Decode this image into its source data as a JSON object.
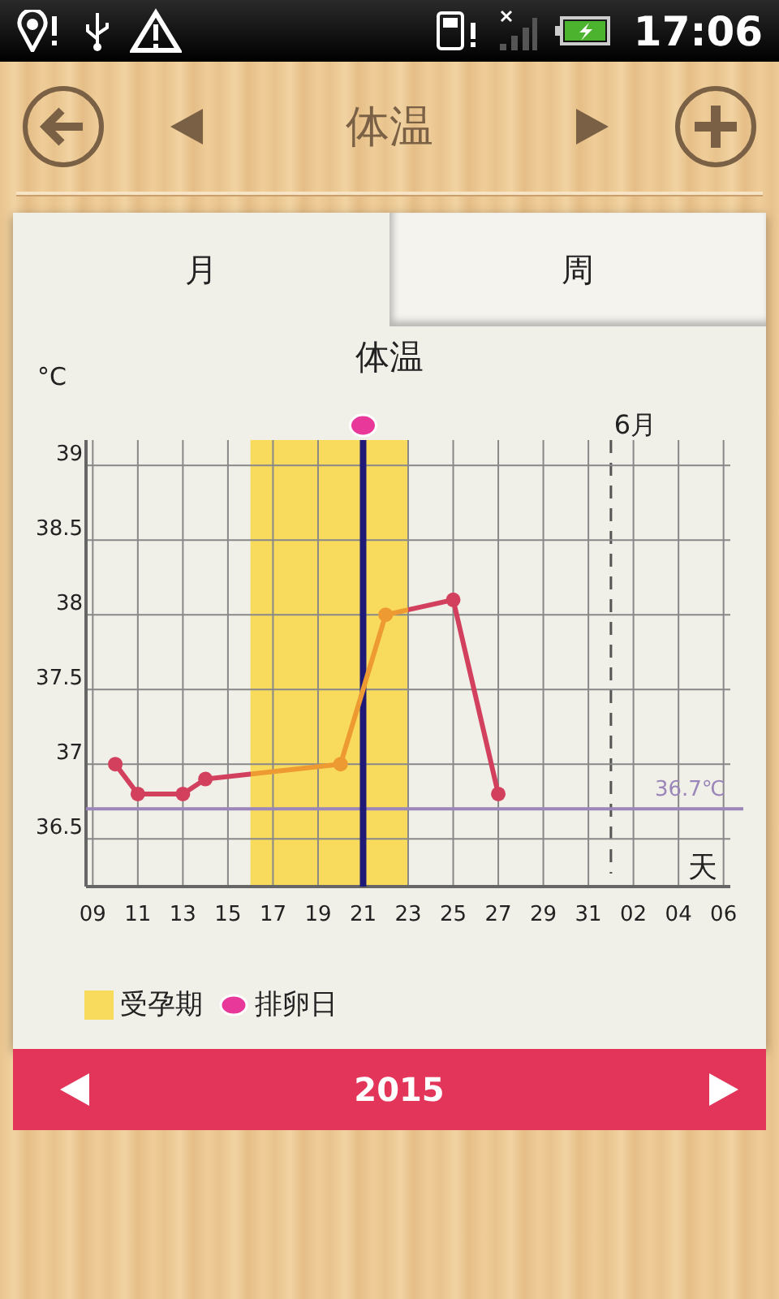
{
  "status_bar": {
    "time": "17:06"
  },
  "header": {
    "title": "体温"
  },
  "tabs": [
    {
      "label": "月",
      "selected": true
    },
    {
      "label": "周",
      "selected": false
    }
  ],
  "chart_data": {
    "type": "line",
    "title": "体温",
    "xlabel": "天",
    "ylabel": "°C",
    "categories": [
      "09",
      null,
      "11",
      null,
      "13",
      null,
      "15",
      null,
      "17",
      null,
      "19",
      null,
      "21",
      null,
      "23",
      null,
      "25",
      null,
      "27",
      null,
      "29",
      null,
      "31",
      null,
      "02",
      null,
      "04",
      null,
      "06"
    ],
    "grid": true,
    "ref_lines": [
      {
        "axis": "y",
        "value": 36.7,
        "label": "36.7℃",
        "color": "#9a86b8"
      },
      {
        "axis": "x",
        "value": "21",
        "color": "#1f1a78"
      }
    ],
    "series": [
      {
        "color": "#d2405e",
        "marker": "o",
        "values": [
          null,
          37.0,
          36.8,
          null,
          36.8,
          36.9,
          null,
          null,
          null,
          null,
          null,
          37.0,
          null,
          38.0,
          null,
          null,
          38.1,
          null,
          36.8,
          null,
          null,
          null,
          null,
          null,
          null,
          null,
          null,
          null,
          null
        ]
      }
    ],
    "ylim": [
      36.18,
      39.17
    ],
    "yticks": [
      {
        "value": 36.5,
        "label": "36.5"
      },
      {
        "value": 37,
        "label": "37"
      },
      {
        "value": 37.5,
        "label": "37.5"
      },
      {
        "value": 38,
        "label": "38"
      },
      {
        "value": 38.5,
        "label": "38.5"
      },
      {
        "value": 39,
        "label": "39"
      }
    ]
  },
  "chart_marks": {
    "month_label": "6月"
  },
  "legend": [
    {
      "kind": "swatch",
      "label": "受孕期"
    },
    {
      "kind": "dot",
      "label": "排卵日"
    }
  ],
  "footer": {
    "year": "2015"
  }
}
